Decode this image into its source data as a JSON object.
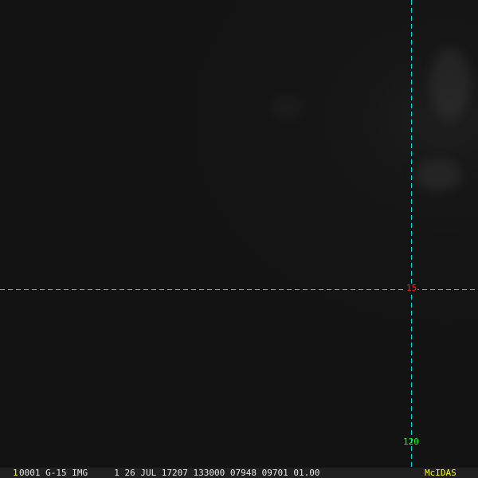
{
  "map": {
    "latitude_label": "15",
    "longitude_label": "120",
    "line_color": "#00e0e0",
    "latitude_label_color": "#ff2020",
    "longitude_label_color": "#20ff20"
  },
  "status_bar": {
    "frame_number": "1",
    "info": "0001 G-15 IMG     1 26 JUL 17207 133000 07948 09701 01.00",
    "brand": "McIDAS"
  }
}
